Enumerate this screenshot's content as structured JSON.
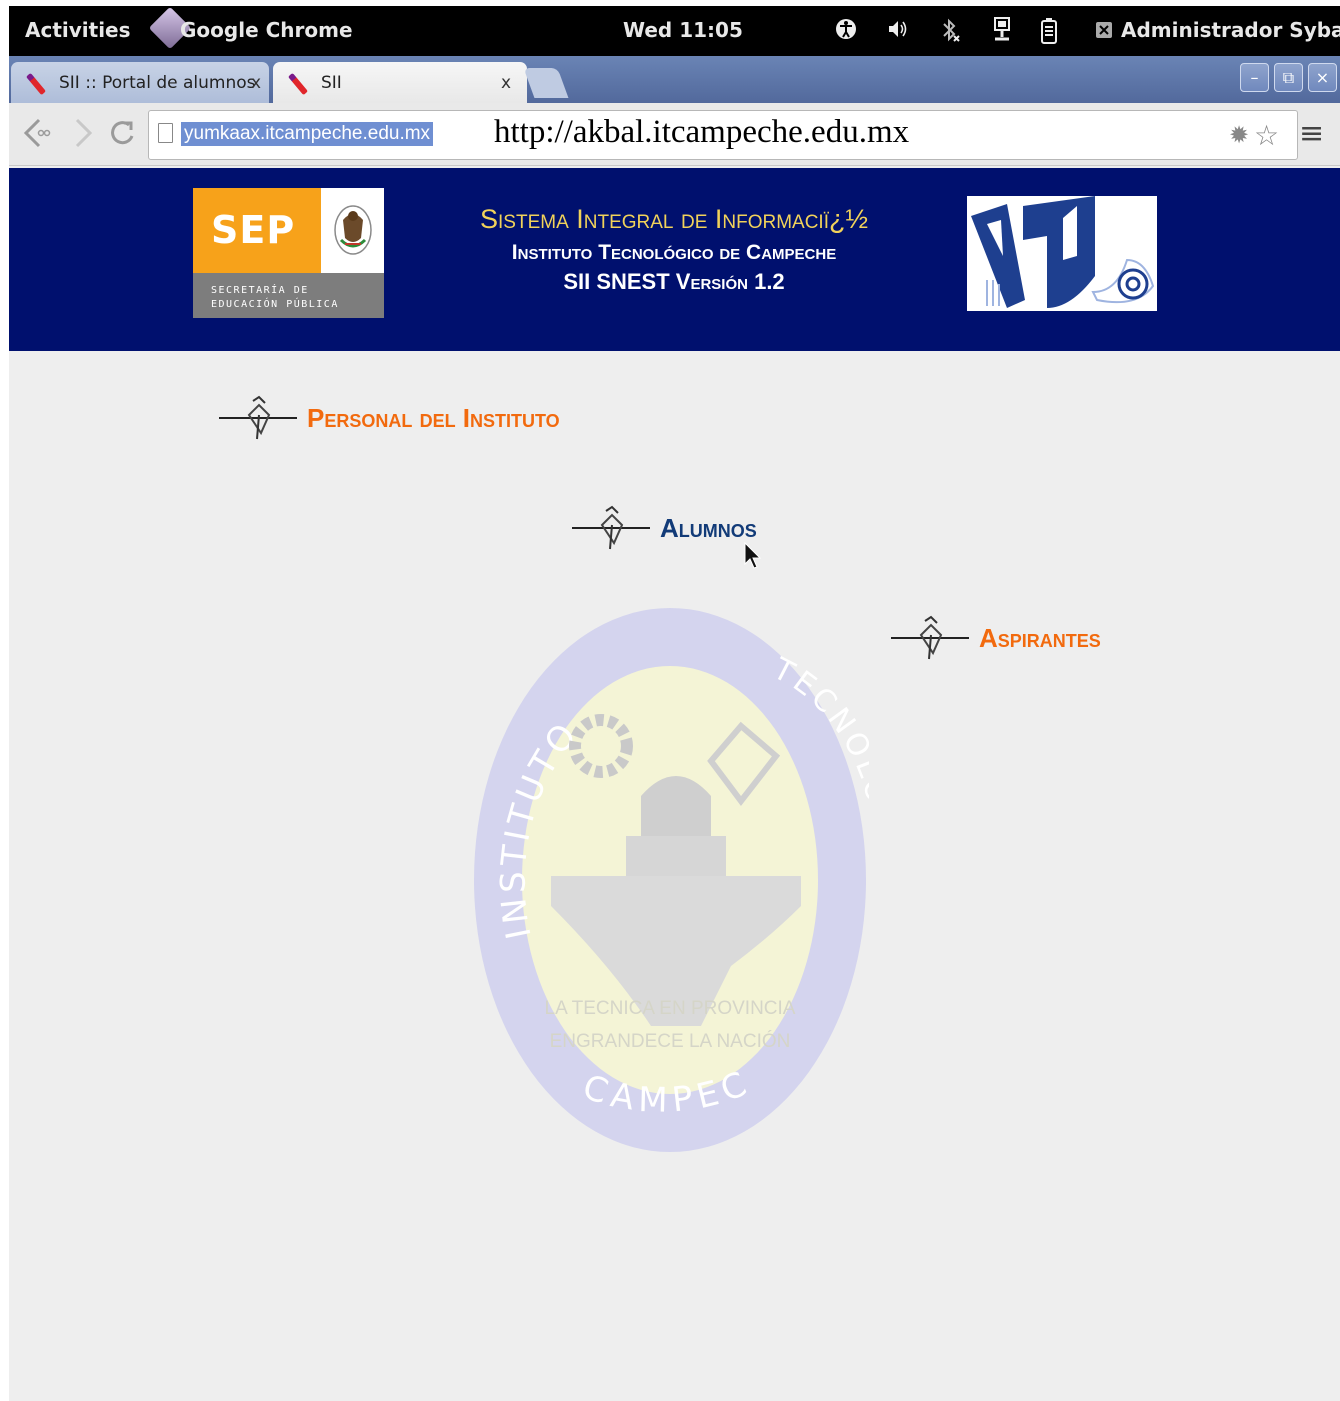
{
  "topbar": {
    "activities": "Activities",
    "app_name": "Google Chrome",
    "clock": "Wed 11:05",
    "user": "Administrador Sybase"
  },
  "tabs": [
    {
      "title": "SII :: Portal de alumnos",
      "close": "x"
    },
    {
      "title": "SII",
      "close": "x"
    }
  ],
  "toolbar": {
    "url": "yumkaax.itcampeche.edu.mx",
    "url_note": "http://akbal.itcampeche.edu.mx"
  },
  "banner": {
    "sep_logo_text": "SEP",
    "sep_sub_line1": "SECRETARÍA DE",
    "sep_sub_line2": "EDUCACIÓN PÚBLICA",
    "system_title": "Sistema Integral de Informaciï¿½",
    "institute": "Instituto Tecnológico de Campeche",
    "version": "SII SNEST Versión 1.2"
  },
  "menu": {
    "personal": "Personal del Instituto",
    "alumnos": "Alumnos",
    "aspirantes": "Aspirantes"
  },
  "seal": {
    "ring_top_left": "INSTITUTO",
    "ring_top_right": "TECNOLOGICO",
    "ring_bottom": "CAMPECHE",
    "motto_line1": "LA TECNICA EN PROVINCIA",
    "motto_line2": "ENGRANDECE LA NACIÓN"
  },
  "colors": {
    "banner_bg": "#00106e",
    "title_yellow": "#f1d25a",
    "link_orange": "#f26a0e",
    "link_blue": "#123b78",
    "tabstrip_blue": "#5a72a8"
  }
}
